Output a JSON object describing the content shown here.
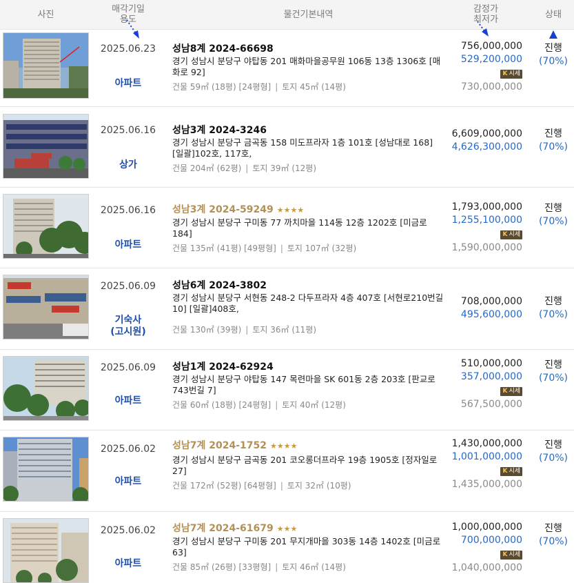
{
  "header": {
    "photo": "사진",
    "date_use": [
      "매각기일",
      "용도"
    ],
    "details": "물건기본내역",
    "prices": [
      "감정가",
      "최저가"
    ],
    "status": "상태"
  },
  "market_badge": "시세",
  "rows": [
    {
      "date": "2025.06.23",
      "use": [
        "아파트"
      ],
      "case": "성남8계 2024-66698",
      "gold": false,
      "stars": "",
      "addr": "경기 성남시 분당구 야탑동 201 매화마을공무원 106동 13층 1306호 [매화로 92]",
      "area": [
        "건물 59㎡ (18평) [24평형]",
        "토지 45㎡ (14평)"
      ],
      "appraisal": "756,000,000",
      "minimum": "529,200,000",
      "market": "730,000,000",
      "status": "진행",
      "pct": "(70%)"
    },
    {
      "date": "2025.06.16",
      "use": [
        "상가"
      ],
      "case": "성남3계 2024-3246",
      "gold": false,
      "stars": "",
      "addr": "경기 성남시 분당구 금곡동 158 미도프라자 1층 101호 [성남대로 168] [일괄]102호, 117호,",
      "area": [
        "건물 204㎡ (62평)",
        "토지 39㎡ (12평)"
      ],
      "appraisal": "6,609,000,000",
      "minimum": "4,626,300,000",
      "market": "",
      "status": "진행",
      "pct": "(70%)"
    },
    {
      "date": "2025.06.16",
      "use": [
        "아파트"
      ],
      "case": "성남3계 2024-59249",
      "gold": true,
      "stars": "★★★★",
      "addr": "경기 성남시 분당구 구미동 77 까치마을 114동 12층 1202호 [미금로 184]",
      "area": [
        "건물 135㎡ (41평) [49평형]",
        "토지 107㎡ (32평)"
      ],
      "appraisal": "1,793,000,000",
      "minimum": "1,255,100,000",
      "market": "1,590,000,000",
      "status": "진행",
      "pct": "(70%)"
    },
    {
      "date": "2025.06.09",
      "use": [
        "기숙사",
        "(고시원)"
      ],
      "case": "성남6계 2024-3802",
      "gold": false,
      "stars": "",
      "addr": "경기 성남시 분당구 서현동 248-2 다두프라자 4층 407호 [서현로210번길 10] [일괄]408호,",
      "area": [
        "건물 130㎡ (39평)",
        "토지 36㎡ (11평)"
      ],
      "appraisal": "708,000,000",
      "minimum": "495,600,000",
      "market": "",
      "status": "진행",
      "pct": "(70%)"
    },
    {
      "date": "2025.06.09",
      "use": [
        "아파트"
      ],
      "case": "성남1계 2024-62924",
      "gold": false,
      "stars": "",
      "addr": "경기 성남시 분당구 야탑동 147 목련마을 SK 601동 2층 203호 [판교로743번길 7]",
      "area": [
        "건물 60㎡ (18평) [24평형]",
        "토지 40㎡ (12평)"
      ],
      "appraisal": "510,000,000",
      "minimum": "357,000,000",
      "market": "567,500,000",
      "status": "진행",
      "pct": "(70%)"
    },
    {
      "date": "2025.06.02",
      "use": [
        "아파트"
      ],
      "case": "성남7계 2024-1752",
      "gold": true,
      "stars": "★★★★",
      "addr": "경기 성남시 분당구 금곡동 201 코오롱더프라우 19층 1905호 [정자일로 27]",
      "area": [
        "건물 172㎡ (52평) [64평형]",
        "토지 32㎡ (10평)"
      ],
      "appraisal": "1,430,000,000",
      "minimum": "1,001,000,000",
      "market": "1,435,000,000",
      "status": "진행",
      "pct": "(70%)"
    },
    {
      "date": "2025.06.02",
      "use": [
        "아파트"
      ],
      "case": "성남7계 2024-61679",
      "gold": true,
      "stars": "★★★",
      "addr": "경기 성남시 분당구 구미동 201 무지개마을 303동 14층 1402호 [미금로 63]",
      "area": [
        "건물 85㎡ (26평) [33평형]",
        "토지 46㎡ (14평)"
      ],
      "appraisal": "1,000,000,000",
      "minimum": "700,000,000",
      "market": "1,040,000,000",
      "status": "진행",
      "pct": "(70%)"
    }
  ],
  "colors": {
    "header_bg": "#f4f4f4",
    "blue": "#2468c8",
    "use_blue": "#1f4fa8",
    "gold": "#b39156",
    "star": "#cc9a32",
    "badge": "#5a4a2f"
  }
}
